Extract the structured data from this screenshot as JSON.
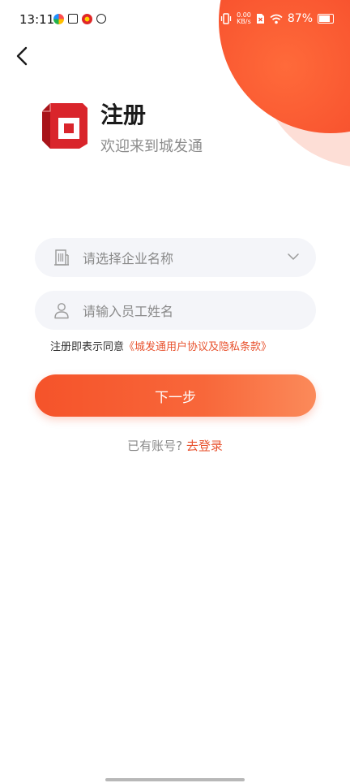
{
  "status_bar": {
    "time": "13:11",
    "net_speed_value": "0.00",
    "net_speed_unit": "KB/s",
    "battery_percent": "87%",
    "icons": [
      "color-wheel-icon",
      "calendar-icon",
      "weibo-icon",
      "link-icon",
      "vibrate-icon",
      "sim-icon",
      "wifi-icon",
      "battery-icon"
    ]
  },
  "header": {
    "title": "注册",
    "subtitle": "欢迎来到城发通"
  },
  "form": {
    "company_placeholder": "请选择企业名称",
    "name_placeholder": "请输入员工姓名",
    "agreement_prefix": "注册即表示同意",
    "agreement_link": "《城发通用户协议及隐私条款》",
    "next_label": "下一步",
    "has_account": "已有账号?",
    "login_link": "去登录"
  },
  "colors": {
    "accent": "#f5532a",
    "link": "#e8532f",
    "field_bg": "#f4f5f9",
    "logo_red": "#d9252b"
  }
}
